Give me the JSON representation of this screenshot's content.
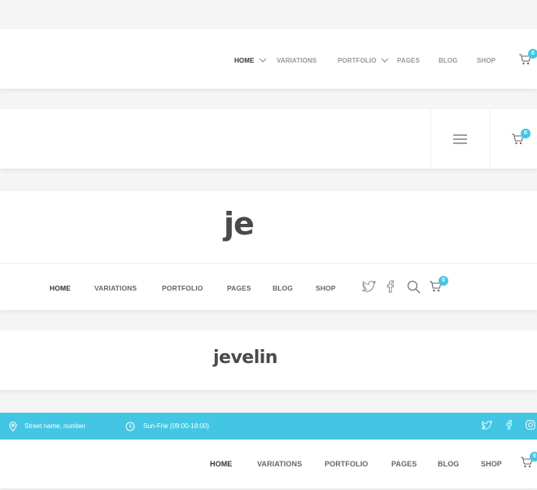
{
  "header1": {
    "nav": [
      "HOME",
      "VARIATIONS",
      "PORTFOLIO",
      "PAGES",
      "BLOG",
      "SHOP"
    ],
    "cart_count": "0"
  },
  "header2": {
    "cart_count": "0"
  },
  "header3": {
    "logo": "je",
    "nav": [
      "HOME",
      "VARIATIONS",
      "PORTFOLIO",
      "PAGES",
      "BLOG",
      "SHOP"
    ],
    "cart_count": "0"
  },
  "header4": {
    "logo": "jevelin"
  },
  "header5": {
    "address": "Street name, number",
    "hours": "Sun-Frie (09:00-18:00)",
    "nav": [
      "HOME",
      "VARIATIONS",
      "PORTFOLIO",
      "PAGES",
      "BLOG",
      "SHOP"
    ],
    "cart_count": "0"
  },
  "colors": {
    "accent": "#43c6e4",
    "active": "#333333",
    "muted": "#999999"
  },
  "icons": [
    "chevron-down-icon",
    "cart-icon",
    "hamburger-icon",
    "twitter-icon",
    "facebook-icon",
    "search-icon",
    "location-icon",
    "clock-icon",
    "instagram-icon"
  ]
}
